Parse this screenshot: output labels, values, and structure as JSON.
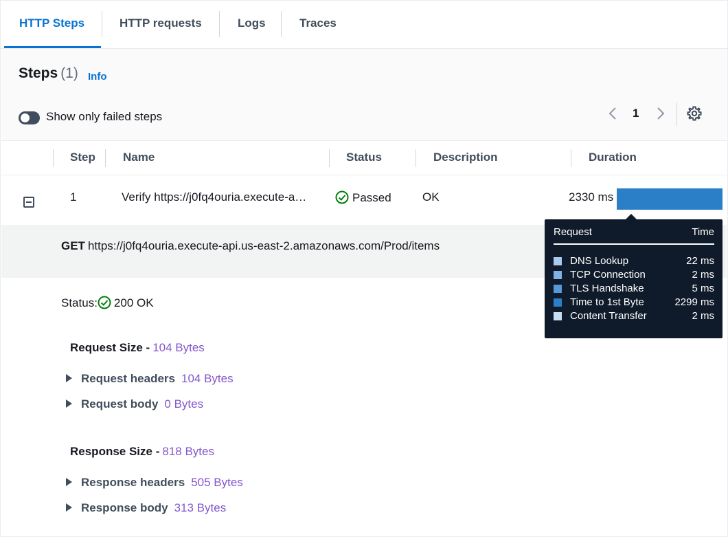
{
  "tabs": [
    {
      "label": "HTTP Steps",
      "active": true
    },
    {
      "label": "HTTP requests",
      "active": false
    },
    {
      "label": "Logs",
      "active": false
    },
    {
      "label": "Traces",
      "active": false
    }
  ],
  "header": {
    "title": "Steps",
    "count": "(1)",
    "info_label": "Info",
    "toggle_label": "Show only failed steps",
    "toggle_on": false
  },
  "pagination": {
    "current_page": "1"
  },
  "table": {
    "columns": [
      "Step",
      "Name",
      "Status",
      "Description",
      "Duration"
    ],
    "rows": [
      {
        "step": "1",
        "name": "Verify https://j0fq4ouria.execute-a…",
        "status": "Passed",
        "description": "OK",
        "duration": "2330 ms"
      }
    ]
  },
  "detail": {
    "method": "GET",
    "url": "https://j0fq4ouria.execute-api.us-east-2.amazonaws.com/Prod/items",
    "status_label": "Status:",
    "status_value": "200 OK",
    "request_size_label": "Request Size -",
    "request_size_value": "104 Bytes",
    "request_headers_label": "Request headers",
    "request_headers_size": "104 Bytes",
    "request_body_label": "Request body",
    "request_body_size": "0 Bytes",
    "response_size_label": "Response Size -",
    "response_size_value": "818 Bytes",
    "response_headers_label": "Response headers",
    "response_headers_size": "505 Bytes",
    "response_body_label": "Response body",
    "response_body_size": "313 Bytes"
  },
  "tooltip": {
    "col_request": "Request",
    "col_time": "Time",
    "rows": [
      {
        "label": "DNS Lookup",
        "time": "22 ms",
        "color": "#a8c9f0"
      },
      {
        "label": "TCP Connection",
        "time": "2 ms",
        "color": "#7fb2e5"
      },
      {
        "label": "TLS Handshake",
        "time": "5 ms",
        "color": "#5599d8"
      },
      {
        "label": "Time to 1st Byte",
        "time": "2299 ms",
        "color": "#2b7fc6"
      },
      {
        "label": "Content Transfer",
        "time": "2 ms",
        "color": "#c9dcf3"
      }
    ]
  },
  "colors": {
    "accent": "#0972d3",
    "success": "#037f0c",
    "size_text": "#8456ce",
    "duration_bar": "#2b7fc6"
  }
}
